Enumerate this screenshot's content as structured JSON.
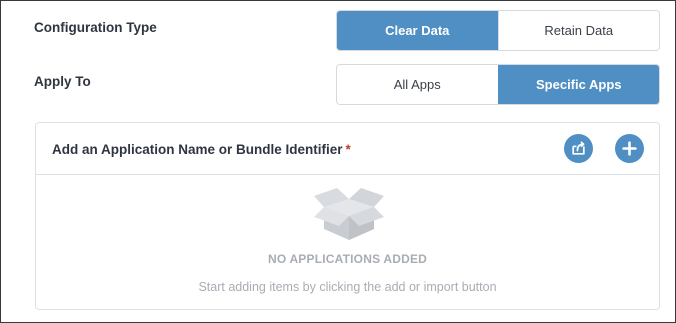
{
  "configuration_type": {
    "label": "Configuration Type",
    "options": [
      "Clear Data",
      "Retain Data"
    ],
    "selected": "Clear Data"
  },
  "apply_to": {
    "label": "Apply To",
    "options": [
      "All Apps",
      "Specific Apps"
    ],
    "selected": "Specific Apps"
  },
  "applications_panel": {
    "title": "Add an Application Name or Bundle Identifier",
    "required_marker": "*",
    "import_button_icon": "import-icon",
    "add_button_icon": "plus-icon",
    "empty_state": {
      "icon": "open-box-icon",
      "title": "NO APPLICATIONS ADDED",
      "subtitle": "Start adding items by clicking the add or import button"
    }
  },
  "colors": {
    "accent": "#4f8fc3",
    "text": "#2f3540",
    "muted_text": "#a8adb4",
    "border": "#d5dae0",
    "required": "#c0392b"
  }
}
